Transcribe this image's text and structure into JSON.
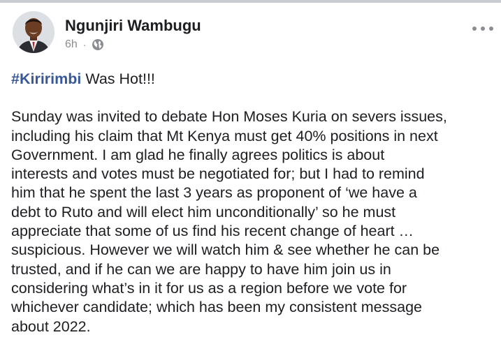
{
  "post": {
    "author_name": "Ngunjiri Wambugu",
    "time": "6h",
    "separator": "·",
    "privacy_icon": "globe-icon",
    "more_icon": "more-options-icon",
    "hashtag": "#Kiririmbi",
    "headline_rest": " Was Hot!!!",
    "body_lines": [
      "Sunday was invited to debate Hon Moses Kuria on severs issues,",
      "including his claim that Mt Kenya must get 40% positions in next",
      "Government. I am glad he finally agrees politics is about",
      "interests and votes must be negotiated for; but I had to remind",
      "him that he spent the last 3 years as proponent of ‘we have a",
      "debt to Ruto and will elect him unconditionally’ so he must",
      "appreciate that some of us find his recent change of heart …",
      "suspicious. However we will watch him & see whether he can be",
      "trusted, and if he can we are happy to have him join us in",
      "considering what’s in it for us as a region before we vote for",
      "whichever candidate; which has been my consistent message",
      "about 2022."
    ]
  },
  "colors": {
    "text": "#1c1e21",
    "secondary": "#8a8d91",
    "hashtag": "#385898",
    "top_strip": "#c9ccd1"
  }
}
